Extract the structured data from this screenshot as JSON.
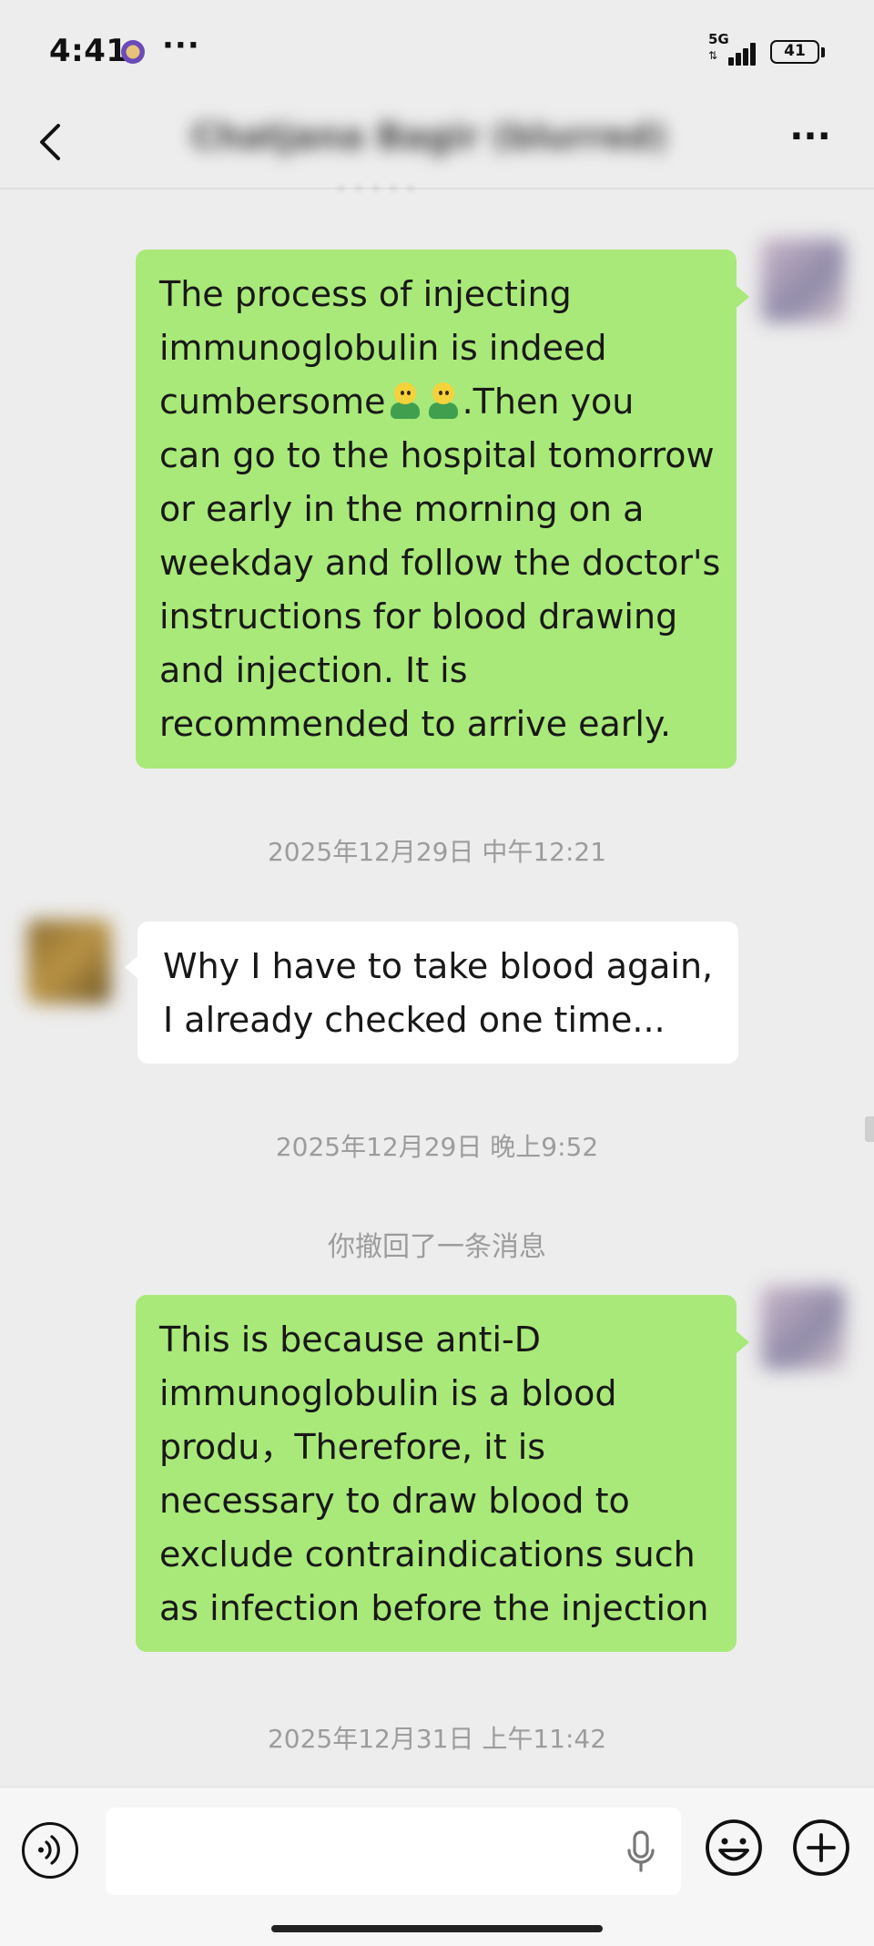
{
  "status_bar": {
    "time": "4:41",
    "more": "···",
    "network": "5G",
    "battery": "41"
  },
  "header": {
    "title": "Chatjana Bagir (blurred)",
    "more": "···"
  },
  "messages": [
    {
      "sender": "me",
      "lines": [
        "The process of injecting",
        "immunoglobulin is indeed",
        "cumbersome[emoji][emoji].Then you",
        "can go to the hospital tomorrow",
        "or early in the morning on a",
        "weekday and follow the doctor's",
        "instructions for blood drawing",
        "and injection. It is",
        "recommended to arrive early."
      ],
      "line3_prefix": "cumbersome",
      "line3_suffix": ".Then you",
      "emoji": "person-shrugging-emoji"
    },
    {
      "sender": "other",
      "lines": [
        "Why I have to take blood again,",
        "I already checked one time..."
      ]
    },
    {
      "sender": "me",
      "lines": [
        "This is because anti-D",
        "immunoglobulin is a blood",
        "produ，Therefore, it is",
        "necessary to draw blood to",
        "exclude contraindications such",
        "as infection before the injection"
      ]
    }
  ],
  "timestamps": [
    "2025年12月29日 中午12:21",
    "2025年12月29日 晚上9:52",
    "2025年12月31日 上午11:42"
  ],
  "recall_notice": "你撤回了一条消息",
  "input_bar": {
    "value": "",
    "placeholder": ""
  },
  "colors": {
    "background": "#ededed",
    "my_bubble": "#a9e979",
    "their_bubble": "#ffffff",
    "timestamp": "#9c9c9c"
  }
}
